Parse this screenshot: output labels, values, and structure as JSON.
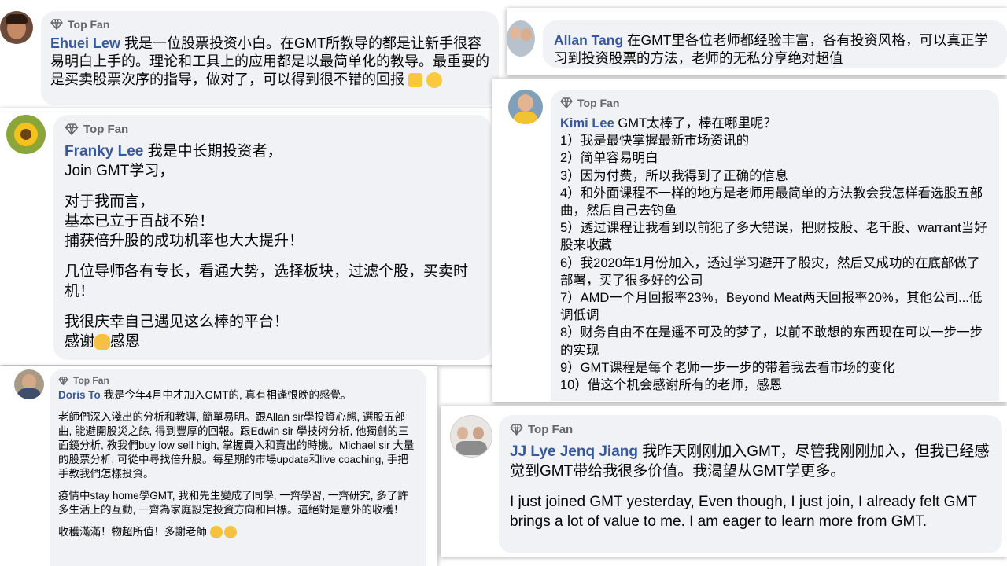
{
  "badge_label": "Top Fan",
  "colors": {
    "bubble_bg": "#f0f2f5",
    "name_blue": "#385898",
    "badge_grey": "#65676b"
  },
  "comments": {
    "ehuei": {
      "name": "Ehuei Lew",
      "text": "我是一位股票投资小白。在GMT所教导的都是让新手很容易明白上手的。理论和工具上的应用都是以最简单化的教导。最重要的是买卖股票次序的指导，做对了，可以得到很不错的回报",
      "emojis": [
        "thumbs-up-emoji",
        "grinning-emoji"
      ]
    },
    "franky": {
      "name": "Franky Lee",
      "line1": "我是中长期投资者，",
      "line2": "Join GMT学习，",
      "para2": "对于我而言，\n基本已立于百战不殆！\n捕获倍升股的成功机率也大大提升！",
      "para3": "几位导师各有专长，看通大势，选择板块，过滤个股，买卖时机！",
      "para4a": "我很庆幸自己遇见这么棒的平台！",
      "para4b_pre": "感谢",
      "para4b_post": "感恩"
    },
    "doris": {
      "name": "Doris To",
      "line1": "我是今年4月中才加入GMT的, 真有相逢恨晚的感覺。",
      "para2": "老師們深入淺出的分析和教導, 簡單易明。跟Allan sir學投資心態, 選股五部曲, 能避開股災之餘, 得到豐厚的回報。跟Edwin sir 學技術分析, 他獨創的三面鏡分析, 教我們buy low sell high, 掌握買入和賣出的時機。Michael sir 大量的股票分析, 可從中尋找倍升股。每星期的市場update和live coaching, 手把手教我們怎樣投資。",
      "para3": "疫情中stay home學GMT, 我和先生變成了同學, 一齊學習, 一齊研究, 多了許多生活上的互動, 一齊為家庭設定投資方向和目標。這絕對是意外的收穫！",
      "para4": "收穫滿滿！物超所值！多謝老師"
    },
    "allan": {
      "name": "Allan Tang",
      "text": "在GMT里各位老师都经验丰富，各有投资风格，可以真正学习到投资股票的方法，老师的无私分享绝对超值"
    },
    "kimi": {
      "name": "Kimi Lee",
      "intro": "GMT太棒了，棒在哪里呢？",
      "items": [
        "1）我是最快掌握最新市场资讯的",
        "2）简单容易明白",
        "3）因为付费，所以我得到了正确的信息",
        "4）和外面课程不一样的地方是老师用最简单的方法教会我怎样看选股五部曲，然后自己去钓鱼",
        "5）透过课程让我看到以前犯了多大错误，把财技股、老千股、warrant当好股来收藏",
        "6）我2020年1月份加入，透过学习避开了股灾，然后又成功的在底部做了部署，买了很多好的公司",
        "7）AMD一个月回报率23%，Beyond Meat两天回报率20%，其他公司...低调低调",
        "8）财务自由不在是遥不可及的梦了，以前不敢想的东西现在可以一步一步的实现",
        "9）GMT课程是每个老师一步一步的带着我去看市场的变化",
        "10）借这个机会感谢所有的老师，感恩"
      ]
    },
    "jj": {
      "name": "JJ Lye Jenq Jiang",
      "text_cn": "我昨天刚刚加入GMT，尽管我刚刚加入，但我已经感觉到GMT带给我很多价值。我渴望从GMT学更多。",
      "text_en": "I just joined GMT yesterday, Even though, I just join, I already felt GMT brings a lot of value to me. I am eager to learn more from GMT."
    }
  }
}
